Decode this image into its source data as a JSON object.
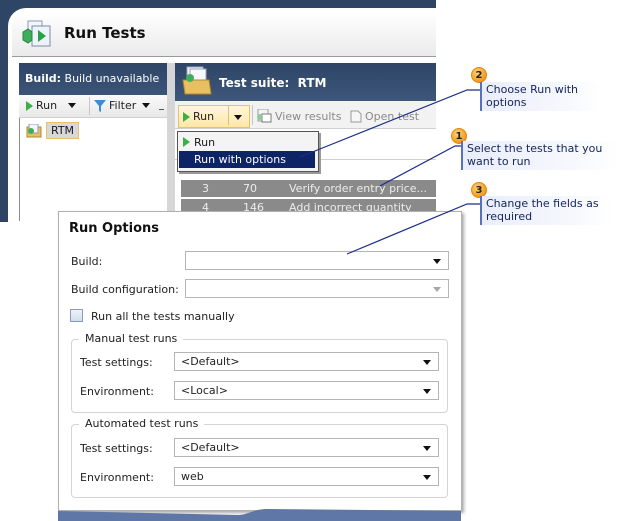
{
  "window": {
    "title": "Run Tests",
    "title_icon": "run-tests-icon"
  },
  "left_pane": {
    "header_label": "Build:",
    "header_value": "Build unavailable",
    "toolbar": {
      "run_label": "Run",
      "filter_label": "Filter"
    },
    "tree": [
      {
        "label": "RTM",
        "icon": "test-suite-folder-icon",
        "selected": true
      }
    ]
  },
  "right_pane": {
    "suite_label": "Test suite:",
    "suite_name": "RTM",
    "toolbar": {
      "run_label": "Run",
      "view_results_label": "View results",
      "open_test_label": "Open test"
    },
    "run_menu": {
      "items": [
        "Run",
        "Run with options"
      ],
      "highlighted": "Run with options"
    },
    "grid_rows": [
      {
        "order": "3",
        "id": "70",
        "title": "Verify order entry price..."
      },
      {
        "order": "4",
        "id": "146",
        "title": "Add incorrect quantity to..."
      }
    ]
  },
  "dialog": {
    "title": "Run Options",
    "build_label": "Build:",
    "build_value": "",
    "build_config_label": "Build configuration:",
    "build_config_value": "",
    "run_manually_label": "Run all the tests manually",
    "run_manually_checked": false,
    "manual_group": {
      "title": "Manual test runs",
      "test_settings_label": "Test settings:",
      "test_settings_value": "<Default>",
      "environment_label": "Environment:",
      "environment_value": "<Local>"
    },
    "automated_group": {
      "title": "Automated test runs",
      "test_settings_label": "Test settings:",
      "test_settings_value": "<Default>",
      "environment_label": "Environment:",
      "environment_value": "web"
    }
  },
  "callouts": [
    {
      "number": "2",
      "text_line1": "Choose Run with",
      "text_line2": "options"
    },
    {
      "number": "1",
      "text_line1": "Select the tests that you",
      "text_line2": "want to run"
    },
    {
      "number": "3",
      "text_line1": "Change the fields as",
      "text_line2": "required"
    }
  ],
  "colors": {
    "window_chrome": "#2e4566",
    "menu_highlight": "#0d2466",
    "callout_badge": "#f39a1e",
    "callout_text": "#15245a",
    "leader_line": "#1c2f86",
    "run_green": "#3cb043"
  }
}
